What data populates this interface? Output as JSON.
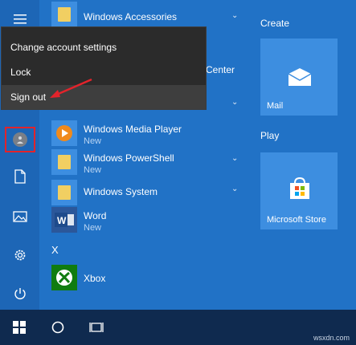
{
  "context_menu": {
    "items": [
      {
        "label": "Change account settings"
      },
      {
        "label": "Lock"
      },
      {
        "label": "Sign out"
      }
    ]
  },
  "app_list": {
    "apps": [
      {
        "name": "Windows Accessories",
        "sub": ""
      },
      {
        "name": "Center",
        "sub": ""
      },
      {
        "name": "Windows Media Player",
        "sub": "New"
      },
      {
        "name": "Windows PowerShell",
        "sub": "New"
      },
      {
        "name": "Windows System",
        "sub": ""
      },
      {
        "name": "Word",
        "sub": "New"
      },
      {
        "name": "Xbox",
        "sub": ""
      }
    ],
    "letter_x": "X"
  },
  "tiles": {
    "create_header": "Create",
    "mail_label": "Mail",
    "play_header": "Play",
    "store_label": "Microsoft Store"
  },
  "taskbar": {
    "watermark": "wsxdn.com"
  },
  "colors": {
    "accent": "#2172c6",
    "highlight": "#e3232b"
  },
  "icons": [
    "hamburger-icon",
    "user-icon",
    "documents-icon",
    "pictures-icon",
    "settings-icon",
    "power-icon",
    "windows-logo-icon",
    "search-circle-icon",
    "task-view-icon",
    "mail-icon",
    "store-icon",
    "xbox-icon",
    "word-icon",
    "media-player-icon",
    "folder-icon",
    "chevron-down-icon"
  ]
}
